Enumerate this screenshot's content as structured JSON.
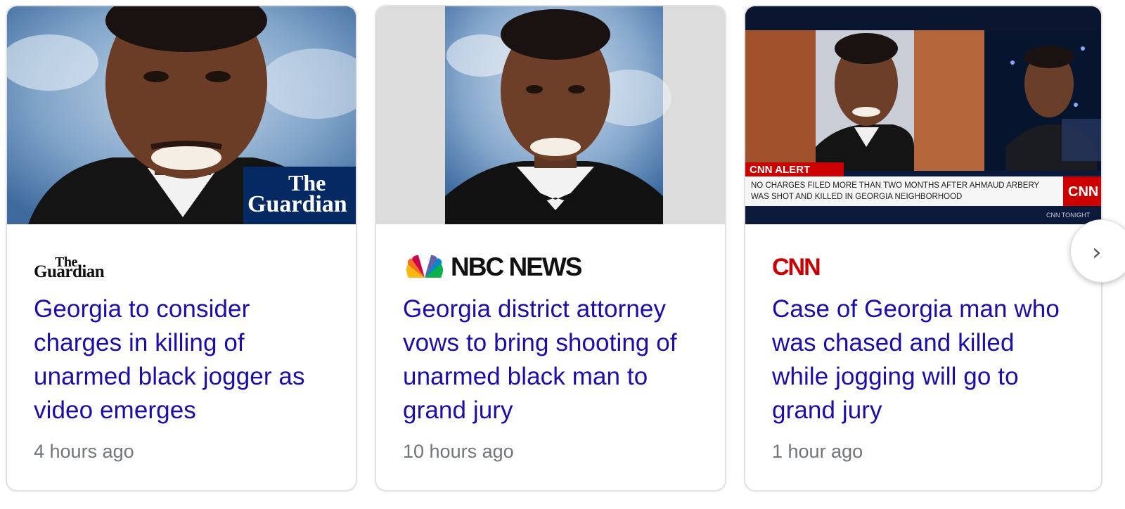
{
  "cards": [
    {
      "source": "The Guardian",
      "logo_line1": "The",
      "logo_line2": "Guardian",
      "thumb_brand_line1": "The",
      "thumb_brand_line2": "Guardian",
      "headline": "Georgia to consider charges in killing of unarmed black jogger as video emerges",
      "time": "4 hours ago"
    },
    {
      "source": "NBC NEWS",
      "logo_text": "NBC NEWS",
      "headline": "Georgia district attorney vows to bring shooting of unarmed black man to grand jury",
      "time": "10 hours ago"
    },
    {
      "source": "CNN",
      "logo_text": "CNN",
      "thumb_alert_label": "CNN ALERT",
      "thumb_alert_line1": "NO CHARGES FILED MORE THAN TWO MONTHS AFTER AHMAUD ARBERY",
      "thumb_alert_line2": "WAS SHOT AND KILLED IN GEORGIA NEIGHBORHOOD",
      "thumb_tonight": "CNN TONIGHT",
      "headline": "Case of Georgia man who was chased and killed while jogging will go to grand jury",
      "time": "1 hour ago"
    }
  ],
  "navigation": {
    "next_icon": "chevron-right-icon",
    "next_glyph": "›"
  },
  "colors": {
    "headline": "#1a0dab",
    "timestamp": "#70757a",
    "cnn_red": "#cc0000",
    "guardian_blue": "#052962"
  }
}
